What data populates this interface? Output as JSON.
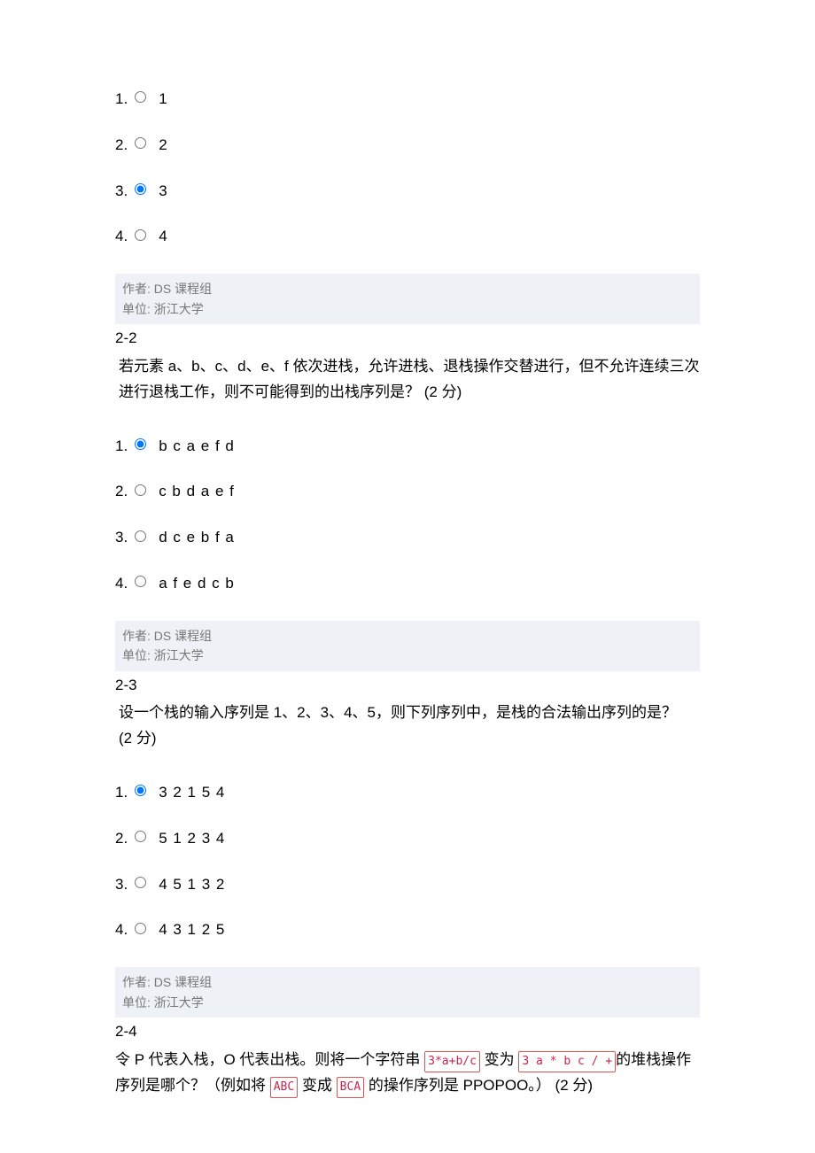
{
  "meta": {
    "author_label": "作者:",
    "author_value": "DS 课程组",
    "unit_label": "单位:",
    "unit_value": "浙江大学"
  },
  "q1": {
    "options": {
      "n1": "1.",
      "v1": "1",
      "n2": "2.",
      "v2": "2",
      "n3": "3.",
      "v3": "3",
      "n4": "4.",
      "v4": "4"
    }
  },
  "q2": {
    "id": "2-2",
    "stem": "若元素 a、b、c、d、e、f 依次进栈，允许进栈、退栈操作交替进行，但不允许连续三次进行退栈工作，则不可能得到的出栈序列是？",
    "pts": "(2 分)",
    "options": {
      "n1": "1.",
      "v1": "b c a e f d",
      "n2": "2.",
      "v2": "c b d a e f",
      "n3": "3.",
      "v3": "d c e b f a",
      "n4": "4.",
      "v4": "a f e d c b"
    }
  },
  "q3": {
    "id": "2-3",
    "stem": "设一个栈的输入序列是 1、2、3、4、5，则下列序列中，是栈的合法输出序列的是？",
    "pts": "(2 分)",
    "options": {
      "n1": "1.",
      "v1": "3 2 1 5 4",
      "n2": "2.",
      "v2": "5 1 2 3 4",
      "n3": "3.",
      "v3": "4 5 1 3 2",
      "n4": "4.",
      "v4": "4 3 1 2 5"
    }
  },
  "q4": {
    "id": "2-4",
    "stem_a": "令 P 代表入栈，O 代表出栈。则将一个字符串 ",
    "code1": "3*a+b/c",
    "stem_b": " 变为 ",
    "code2": "3 a * b c / +",
    "stem_c": "的堆栈操作序列是哪个？（例如将 ",
    "code3": "ABC",
    "stem_d": " 变成 ",
    "code4": "BCA",
    "stem_e": " 的操作序列是 PPOPOO。）",
    "pts": "(2 分)"
  }
}
